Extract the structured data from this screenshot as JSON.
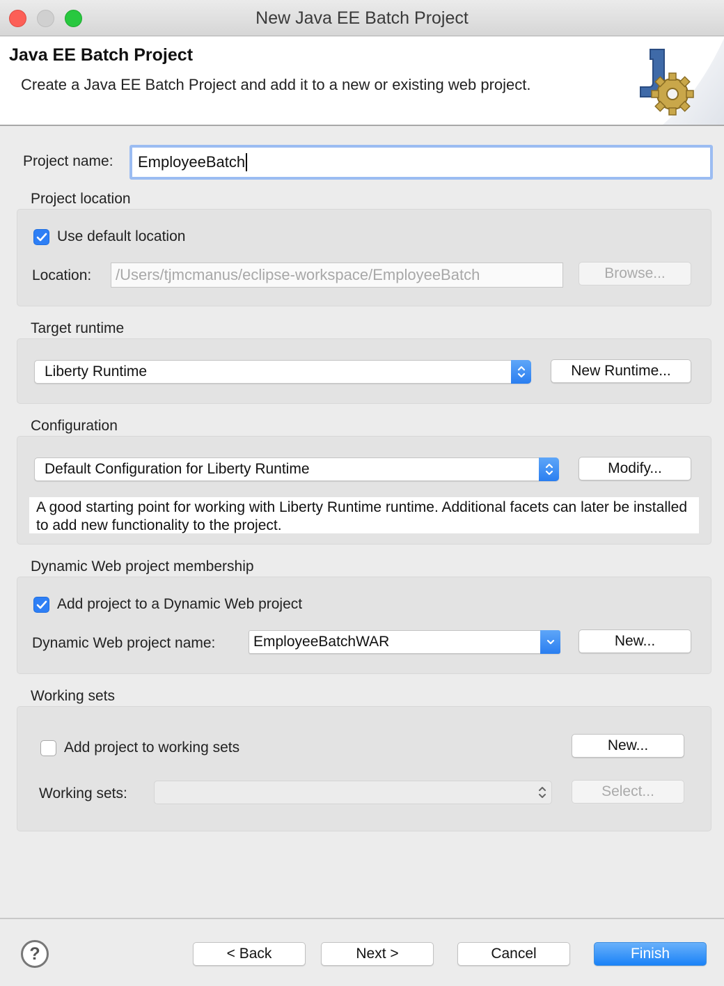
{
  "window": {
    "title": "New Java EE Batch Project"
  },
  "header": {
    "title": "Java EE Batch Project",
    "description": "Create a Java EE Batch Project and add it to a new or existing web project."
  },
  "project_name": {
    "label": "Project name:",
    "value": "EmployeeBatch"
  },
  "project_location": {
    "group_label": "Project location",
    "use_default_label": "Use default location",
    "use_default_checked": true,
    "location_label": "Location:",
    "location_value": "/Users/tjmcmanus/eclipse-workspace/EmployeeBatch",
    "browse_label": "Browse..."
  },
  "target_runtime": {
    "group_label": "Target runtime",
    "selected": "Liberty Runtime",
    "new_runtime_label": "New Runtime..."
  },
  "configuration": {
    "group_label": "Configuration",
    "selected": "Default Configuration for Liberty Runtime",
    "modify_label": "Modify...",
    "description": "A good starting point for working with Liberty Runtime runtime. Additional facets can later be installed to add new functionality to the project."
  },
  "web_membership": {
    "group_label": "Dynamic Web project membership",
    "add_label": "Add project to a Dynamic Web project",
    "add_checked": true,
    "name_label": "Dynamic Web project name:",
    "name_value": "EmployeeBatchWAR",
    "new_label": "New..."
  },
  "working_sets": {
    "group_label": "Working sets",
    "add_label": "Add project to working sets",
    "add_checked": false,
    "new_label": "New...",
    "sets_label": "Working sets:",
    "sets_value": "",
    "select_label": "Select..."
  },
  "footer": {
    "help_label": "?",
    "back_label": "< Back",
    "next_label": "Next >",
    "cancel_label": "Cancel",
    "finish_label": "Finish"
  },
  "icons": {
    "header": "java-batch-wizard-icon",
    "help": "help-icon",
    "checkmark": "checkmark-icon",
    "combo_arrows": "updown-chevron-icon",
    "dropdown": "chevron-down-icon"
  }
}
